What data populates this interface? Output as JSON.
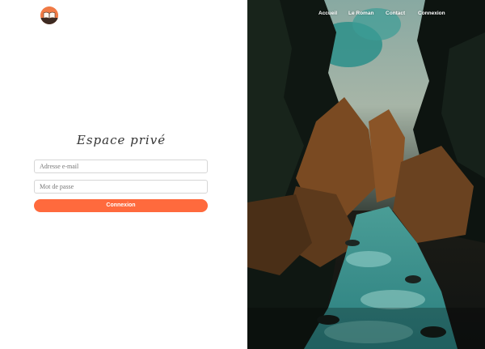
{
  "header": {
    "logo_icon": "open-book-logo",
    "nav": [
      {
        "label": "Accueil"
      },
      {
        "label": "Le Roman"
      },
      {
        "label": "Contact"
      },
      {
        "label": "Connexion"
      }
    ]
  },
  "login": {
    "title": "Espace privé",
    "email_placeholder": "Adresse e-mail",
    "password_placeholder": "Mot de passe",
    "submit_label": "Connexion"
  },
  "colors": {
    "accent": "#ff6a3d",
    "logo_bg": "#f07a45",
    "river": "#2f8f8c"
  }
}
